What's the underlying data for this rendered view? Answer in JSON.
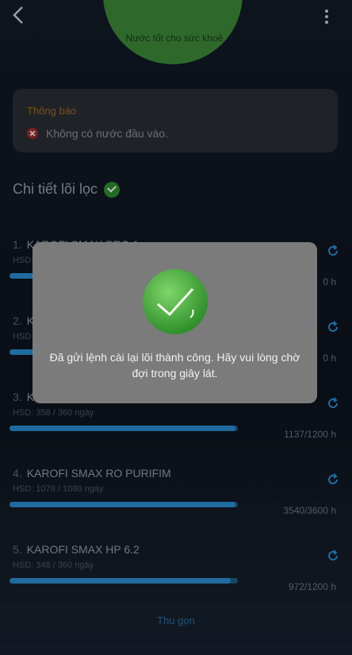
{
  "circle": {
    "text": "Nước tốt cho sức khoẻ"
  },
  "warning": {
    "title": "Thông báo",
    "message": "Không có nước đầu vào."
  },
  "section": {
    "title": "Chi tiết lõi lọc"
  },
  "filters": [
    {
      "index": "1.",
      "name": "KAROFI SMAX PRO 1",
      "hsd": "HSD:",
      "hours": "0 h",
      "progress": 0.98
    },
    {
      "index": "2.",
      "name": "K",
      "hsd": "HSD",
      "hours": "0 h",
      "progress": 0.98
    },
    {
      "index": "3.",
      "name": "K",
      "hsd": "HSD: 358 / 360 ngày",
      "hours": "1137/1200 h",
      "progress": 0.99
    },
    {
      "index": "4.",
      "name": "KAROFI SMAX RO PURIFIM",
      "hsd": "HSD: 1078 / 1080 ngày",
      "hours": "3540/3600 h",
      "progress": 0.99
    },
    {
      "index": "5.",
      "name": "KAROFI SMAX HP 6.2",
      "hsd": "HSD: 348 / 360 ngày",
      "hours": "972/1200 h",
      "progress": 0.97
    }
  ],
  "collapse_label": "Thu gọn",
  "toast": {
    "message": "Đã gửi lệnh cài lại lõi thành công. Hãy vui lòng chờ đợi trong giây lát."
  },
  "colors": {
    "accent": "#2a8fd4",
    "success": "#3aa63a"
  }
}
